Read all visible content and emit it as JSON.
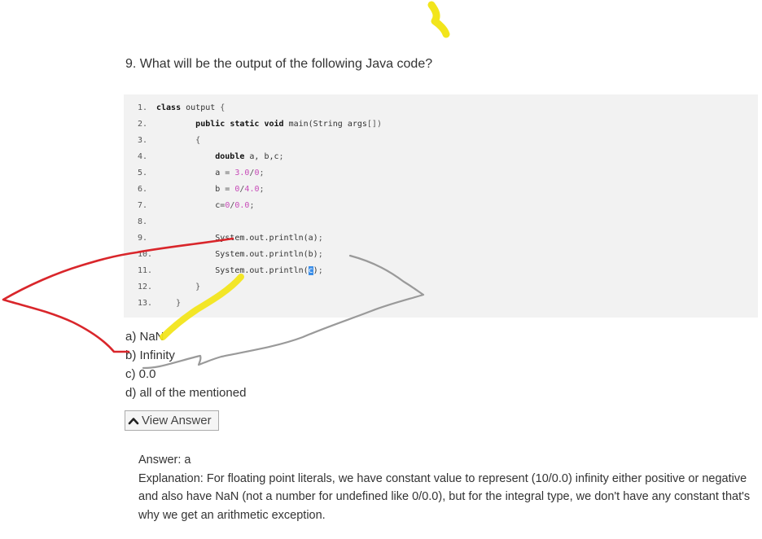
{
  "question": {
    "text": "9. What will be the output of the following Java code?"
  },
  "code": {
    "lines": [
      {
        "no": "1.",
        "tokens": [
          [
            "kw",
            "class"
          ],
          [
            "",
            " output "
          ],
          [
            "pun",
            "{"
          ]
        ]
      },
      {
        "no": "2.",
        "tokens": [
          [
            "",
            "        "
          ],
          [
            "kw",
            "public static void"
          ],
          [
            "",
            " main(String args"
          ],
          [
            "pun",
            "[])"
          ]
        ]
      },
      {
        "no": "3.",
        "tokens": [
          [
            "",
            "        "
          ],
          [
            "pun",
            "{"
          ]
        ]
      },
      {
        "no": "4.",
        "tokens": [
          [
            "",
            "            "
          ],
          [
            "kw",
            "double"
          ],
          [
            "",
            " a, b,c"
          ],
          [
            "pun",
            ";"
          ]
        ]
      },
      {
        "no": "5.",
        "tokens": [
          [
            "",
            "            a "
          ],
          [
            "pun",
            "="
          ],
          [
            "",
            " "
          ],
          [
            "num",
            "3.0"
          ],
          [
            "pun",
            "/"
          ],
          [
            "num",
            "0"
          ],
          [
            "pun",
            ";"
          ]
        ]
      },
      {
        "no": "6.",
        "tokens": [
          [
            "",
            "            b "
          ],
          [
            "pun",
            "="
          ],
          [
            "",
            " "
          ],
          [
            "num",
            "0"
          ],
          [
            "pun",
            "/"
          ],
          [
            "num",
            "4.0"
          ],
          [
            "pun",
            ";"
          ]
        ]
      },
      {
        "no": "7.",
        "tokens": [
          [
            "",
            "            c"
          ],
          [
            "pun",
            "="
          ],
          [
            "num",
            "0"
          ],
          [
            "pun",
            "/"
          ],
          [
            "num",
            "0.0"
          ],
          [
            "pun",
            ";"
          ]
        ]
      },
      {
        "no": "8.",
        "tokens": []
      },
      {
        "no": "9.",
        "tokens": [
          [
            "",
            "            System.out.println(a)"
          ],
          [
            "pun",
            ";"
          ]
        ]
      },
      {
        "no": "10.",
        "tokens": [
          [
            "",
            "            System.out.println(b)"
          ],
          [
            "pun",
            ";"
          ]
        ]
      },
      {
        "no": "11.",
        "tokens": [
          [
            "",
            "            System.out.println("
          ],
          [
            "sel",
            "c"
          ],
          [
            "",
            ")"
          ],
          [
            "pun",
            ";"
          ]
        ]
      },
      {
        "no": "12.",
        "tokens": [
          [
            "",
            "        "
          ],
          [
            "pun",
            "}"
          ]
        ]
      },
      {
        "no": "13.",
        "tokens": [
          [
            "",
            "    "
          ],
          [
            "pun",
            "}"
          ]
        ]
      }
    ]
  },
  "options": [
    {
      "label": "a) NaN"
    },
    {
      "label": "b) Infinity"
    },
    {
      "label": "c) 0.0"
    },
    {
      "label": "d) all of the mentioned"
    }
  ],
  "view_answer": {
    "label": "View Answer",
    "icon": "caret-up-icon"
  },
  "answer": {
    "title": "Answer: a",
    "explanation": "Explanation: For floating point literals, we have constant value to represent (10/0.0) infinity either positive or negative and also have NaN (not a number for undefined like 0/0.0), but for the integral type, we don't have any constant that's why we get an arithmetic exception."
  },
  "colors": {
    "code_background": "#f2f2f2",
    "number_literal": "#c74bb8",
    "selection": "#3b8ee8",
    "red_annotation": "#d9262b",
    "yellow_annotation": "#f2e51b",
    "gray_annotation": "#9a9a9a"
  }
}
